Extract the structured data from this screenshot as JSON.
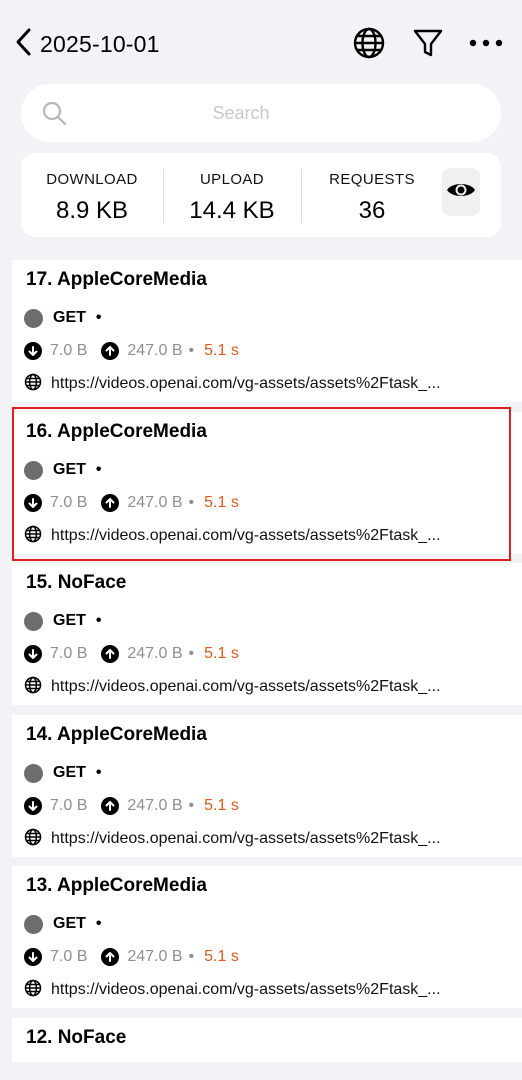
{
  "header": {
    "title": "2025-10-01"
  },
  "search": {
    "placeholder": "Search",
    "value": ""
  },
  "stats": {
    "download_label": "DOWNLOAD",
    "download_value": "8.9 KB",
    "upload_label": "UPLOAD",
    "upload_value": "14.4 KB",
    "requests_label": "REQUESTS",
    "requests_value": "36"
  },
  "requests": [
    {
      "name": "17. AppleCoreMedia",
      "method": "GET",
      "dot": "•",
      "down": "7.0 B",
      "up": "247.0 B",
      "sep": "•",
      "time": "5.1 s",
      "url": "https://videos.openai.com/vg-assets/assets%2Ftask_..."
    },
    {
      "name": "16. AppleCoreMedia",
      "method": "GET",
      "dot": "•",
      "down": "7.0 B",
      "up": "247.0 B",
      "sep": "•",
      "time": "5.1 s",
      "url": "https://videos.openai.com/vg-assets/assets%2Ftask_..."
    },
    {
      "name": "15. NoFace",
      "method": "GET",
      "dot": "•",
      "down": "7.0 B",
      "up": "247.0 B",
      "sep": "•",
      "time": "5.1 s",
      "url": "https://videos.openai.com/vg-assets/assets%2Ftask_..."
    },
    {
      "name": "14. AppleCoreMedia",
      "method": "GET",
      "dot": "•",
      "down": "7.0 B",
      "up": "247.0 B",
      "sep": "•",
      "time": "5.1 s",
      "url": "https://videos.openai.com/vg-assets/assets%2Ftask_..."
    },
    {
      "name": "13. AppleCoreMedia",
      "method": "GET",
      "dot": "•",
      "down": "7.0 B",
      "up": "247.0 B",
      "sep": "•",
      "time": "5.1 s",
      "url": "https://videos.openai.com/vg-assets/assets%2Ftask_..."
    },
    {
      "name": "12. NoFace"
    }
  ],
  "colors": {
    "accent": "#e25a1c",
    "highlight": "#e0201c",
    "background": "#f2f2f7"
  },
  "icons": [
    "back-chevron-icon",
    "globe-icon",
    "filter-icon",
    "more-icon",
    "search-icon",
    "eye-icon",
    "download-arrow-icon",
    "upload-arrow-icon",
    "globe-icon"
  ]
}
